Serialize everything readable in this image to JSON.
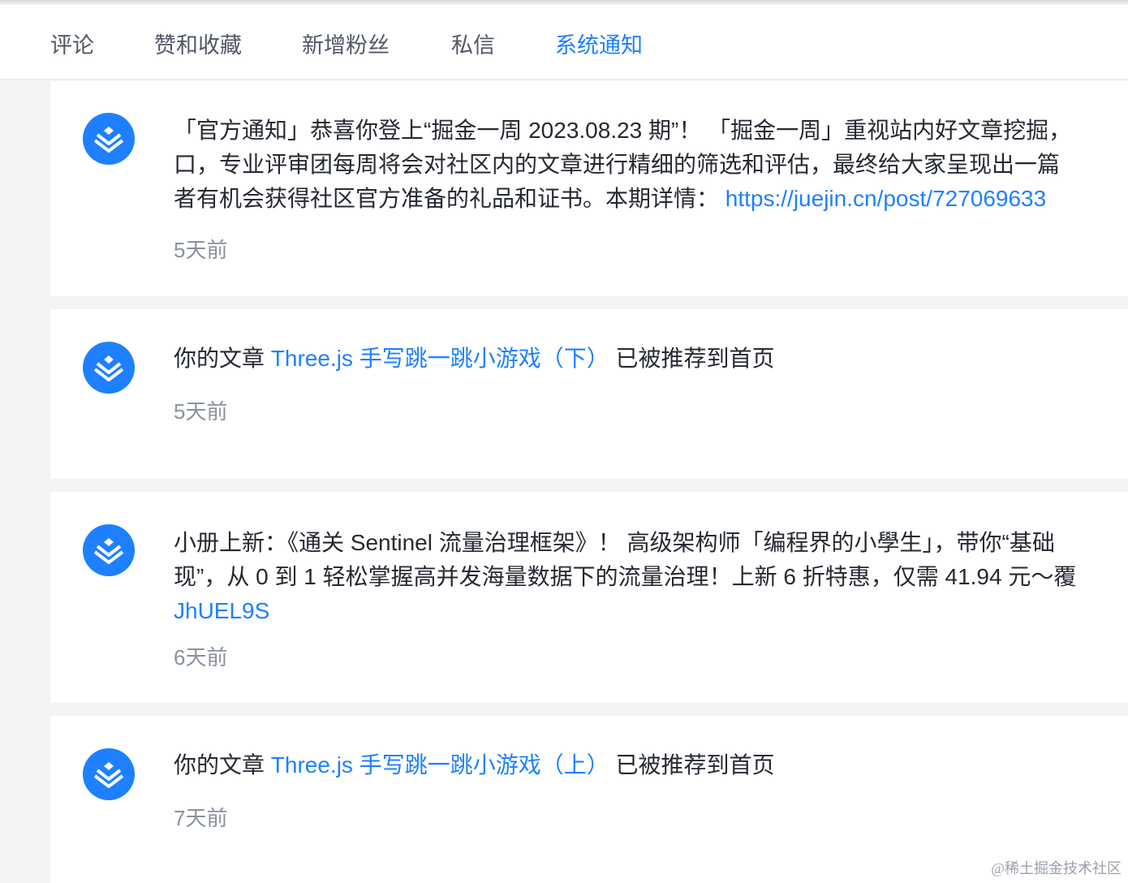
{
  "tabs": [
    {
      "label": "评论",
      "active": false
    },
    {
      "label": "赞和收藏",
      "active": false
    },
    {
      "label": "新增粉丝",
      "active": false
    },
    {
      "label": "私信",
      "active": false
    },
    {
      "label": "系统通知",
      "active": true
    }
  ],
  "notifications": [
    {
      "icon": "juejin-logo-icon",
      "lines": [
        "「官方通知」恭喜你登上“掘金一周 2023.08.23 期”！ 「掘金一周」重视站内好文章挖掘，",
        "口，专业评审团每周将会对社区内的文章进行精细的筛选和评估，最终给大家呈现出一篇",
        "者有机会获得社区官方准备的礼品和证书。本期详情： "
      ],
      "link": "https://juejin.cn/post/727069633",
      "time": "5天前"
    },
    {
      "icon": "juejin-logo-icon",
      "prefix": "你的文章 ",
      "link": "Three.js 手写跳一跳小游戏（下）",
      "suffix": " 已被推荐到首页",
      "time": "5天前"
    },
    {
      "icon": "juejin-logo-icon",
      "lines": [
        "小册上新：《通关 Sentinel 流量治理框架》！ 高级架构师「编程界的小學生」，带你“基础",
        "现”，从 0 到 1 轻松掌握高并发海量数据下的流量治理！上新 6 折特惠，仅需 41.94 元～覆"
      ],
      "link": "JhUEL9S",
      "time": "6天前"
    },
    {
      "icon": "juejin-logo-icon",
      "prefix": "你的文章 ",
      "link": "Three.js 手写跳一跳小游戏（上）",
      "suffix": " 已被推荐到首页",
      "time": "7天前"
    }
  ],
  "watermark": "@稀土掘金技术社区",
  "colors": {
    "accent": "#1e80ff",
    "text": "#252933",
    "muted": "#8a919f",
    "background": "#f2f3f5"
  }
}
